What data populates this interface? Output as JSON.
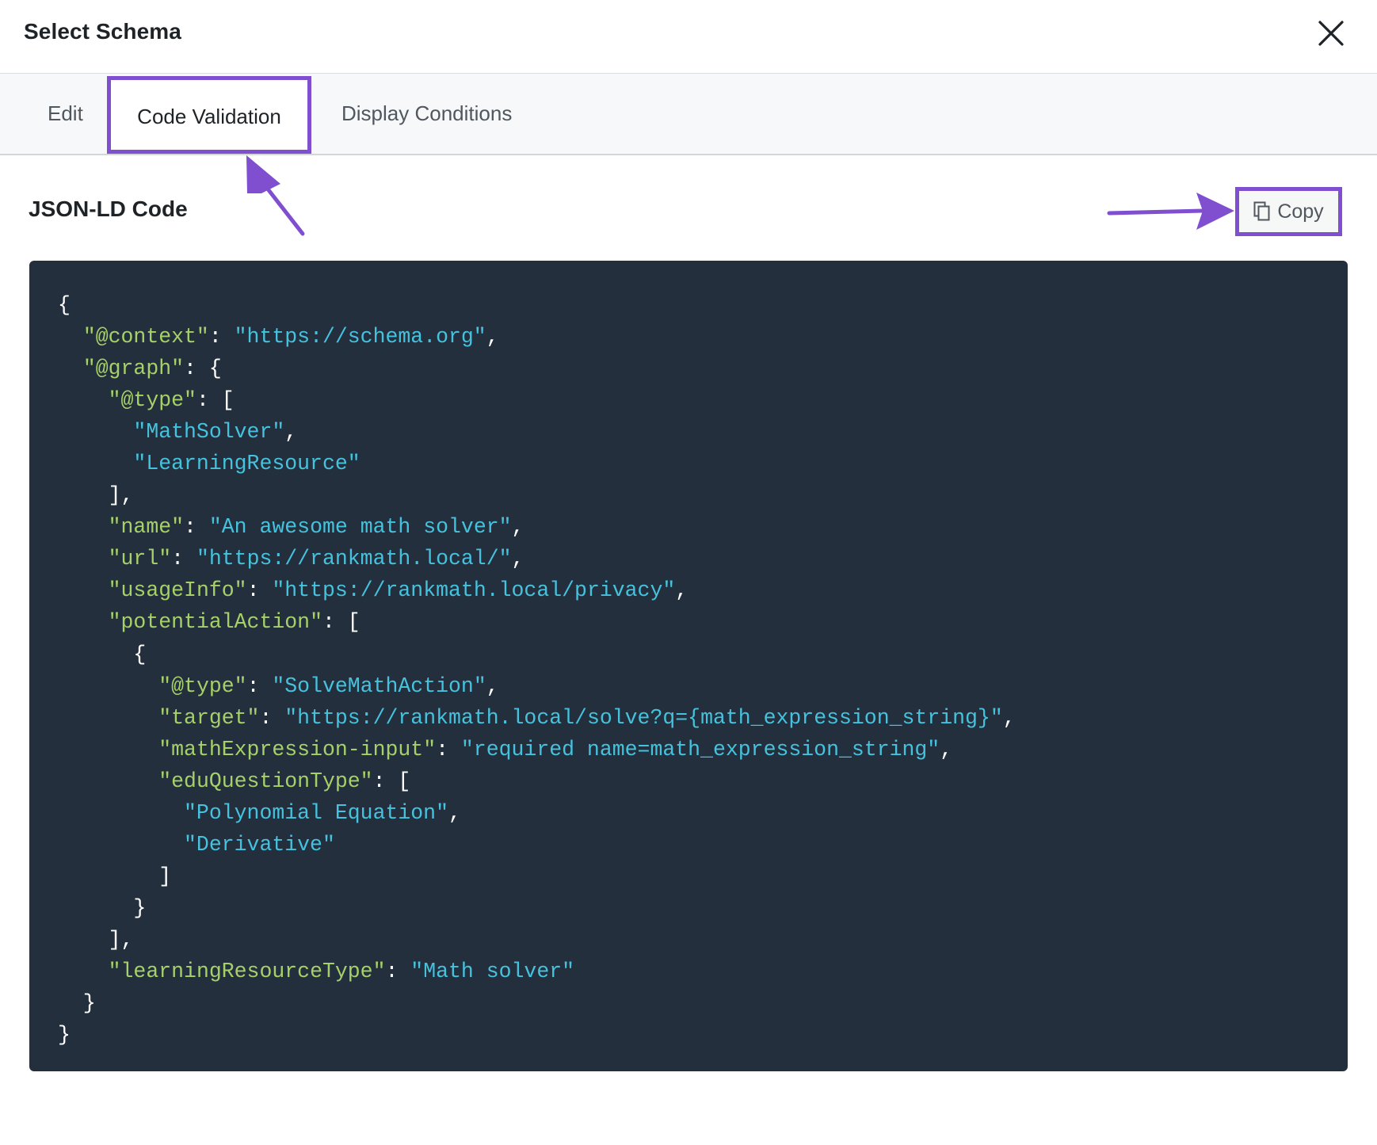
{
  "header": {
    "title": "Select Schema",
    "close_icon": "close-icon"
  },
  "tabs": [
    {
      "label": "Edit",
      "active": false
    },
    {
      "label": "Code Validation",
      "active": true
    },
    {
      "label": "Display Conditions",
      "active": false
    }
  ],
  "section": {
    "title": "JSON-LD Code",
    "copy_label": "Copy",
    "copy_icon": "copy-icon"
  },
  "colors": {
    "annotation": "#7f4fd0",
    "code_background": "#242f3e",
    "code_key": "#a6d169",
    "code_string": "#45c2dd"
  },
  "code": {
    "lines": [
      [
        {
          "t": "p",
          "v": "{"
        }
      ],
      [
        {
          "t": "p",
          "v": "  "
        },
        {
          "t": "k",
          "v": "\"@context\""
        },
        {
          "t": "p",
          "v": ": "
        },
        {
          "t": "s",
          "v": "\"https://schema.org\""
        },
        {
          "t": "p",
          "v": ","
        }
      ],
      [
        {
          "t": "p",
          "v": "  "
        },
        {
          "t": "k",
          "v": "\"@graph\""
        },
        {
          "t": "p",
          "v": ": {"
        }
      ],
      [
        {
          "t": "p",
          "v": "    "
        },
        {
          "t": "k",
          "v": "\"@type\""
        },
        {
          "t": "p",
          "v": ": ["
        }
      ],
      [
        {
          "t": "p",
          "v": "      "
        },
        {
          "t": "s",
          "v": "\"MathSolver\""
        },
        {
          "t": "p",
          "v": ","
        }
      ],
      [
        {
          "t": "p",
          "v": "      "
        },
        {
          "t": "s",
          "v": "\"LearningResource\""
        }
      ],
      [
        {
          "t": "p",
          "v": "    ],"
        }
      ],
      [
        {
          "t": "p",
          "v": "    "
        },
        {
          "t": "k",
          "v": "\"name\""
        },
        {
          "t": "p",
          "v": ": "
        },
        {
          "t": "s",
          "v": "\"An awesome math solver\""
        },
        {
          "t": "p",
          "v": ","
        }
      ],
      [
        {
          "t": "p",
          "v": "    "
        },
        {
          "t": "k",
          "v": "\"url\""
        },
        {
          "t": "p",
          "v": ": "
        },
        {
          "t": "s",
          "v": "\"https://rankmath.local/\""
        },
        {
          "t": "p",
          "v": ","
        }
      ],
      [
        {
          "t": "p",
          "v": "    "
        },
        {
          "t": "k",
          "v": "\"usageInfo\""
        },
        {
          "t": "p",
          "v": ": "
        },
        {
          "t": "s",
          "v": "\"https://rankmath.local/privacy\""
        },
        {
          "t": "p",
          "v": ","
        }
      ],
      [
        {
          "t": "p",
          "v": "    "
        },
        {
          "t": "k",
          "v": "\"potentialAction\""
        },
        {
          "t": "p",
          "v": ": ["
        }
      ],
      [
        {
          "t": "p",
          "v": "      {"
        }
      ],
      [
        {
          "t": "p",
          "v": "        "
        },
        {
          "t": "k",
          "v": "\"@type\""
        },
        {
          "t": "p",
          "v": ": "
        },
        {
          "t": "s",
          "v": "\"SolveMathAction\""
        },
        {
          "t": "p",
          "v": ","
        }
      ],
      [
        {
          "t": "p",
          "v": "        "
        },
        {
          "t": "k",
          "v": "\"target\""
        },
        {
          "t": "p",
          "v": ": "
        },
        {
          "t": "s",
          "v": "\"https://rankmath.local/solve?q={math_expression_string}\""
        },
        {
          "t": "p",
          "v": ","
        }
      ],
      [
        {
          "t": "p",
          "v": "        "
        },
        {
          "t": "k",
          "v": "\"mathExpression-input\""
        },
        {
          "t": "p",
          "v": ": "
        },
        {
          "t": "s",
          "v": "\"required name=math_expression_string\""
        },
        {
          "t": "p",
          "v": ","
        }
      ],
      [
        {
          "t": "p",
          "v": "        "
        },
        {
          "t": "k",
          "v": "\"eduQuestionType\""
        },
        {
          "t": "p",
          "v": ": ["
        }
      ],
      [
        {
          "t": "p",
          "v": "          "
        },
        {
          "t": "s",
          "v": "\"Polynomial Equation\""
        },
        {
          "t": "p",
          "v": ","
        }
      ],
      [
        {
          "t": "p",
          "v": "          "
        },
        {
          "t": "s",
          "v": "\"Derivative\""
        }
      ],
      [
        {
          "t": "p",
          "v": "        ]"
        }
      ],
      [
        {
          "t": "p",
          "v": "      }"
        }
      ],
      [
        {
          "t": "p",
          "v": "    ],"
        }
      ],
      [
        {
          "t": "p",
          "v": "    "
        },
        {
          "t": "k",
          "v": "\"learningResourceType\""
        },
        {
          "t": "p",
          "v": ": "
        },
        {
          "t": "s",
          "v": "\"Math solver\""
        }
      ],
      [
        {
          "t": "p",
          "v": "  }"
        }
      ],
      [
        {
          "t": "p",
          "v": "}"
        }
      ]
    ]
  }
}
